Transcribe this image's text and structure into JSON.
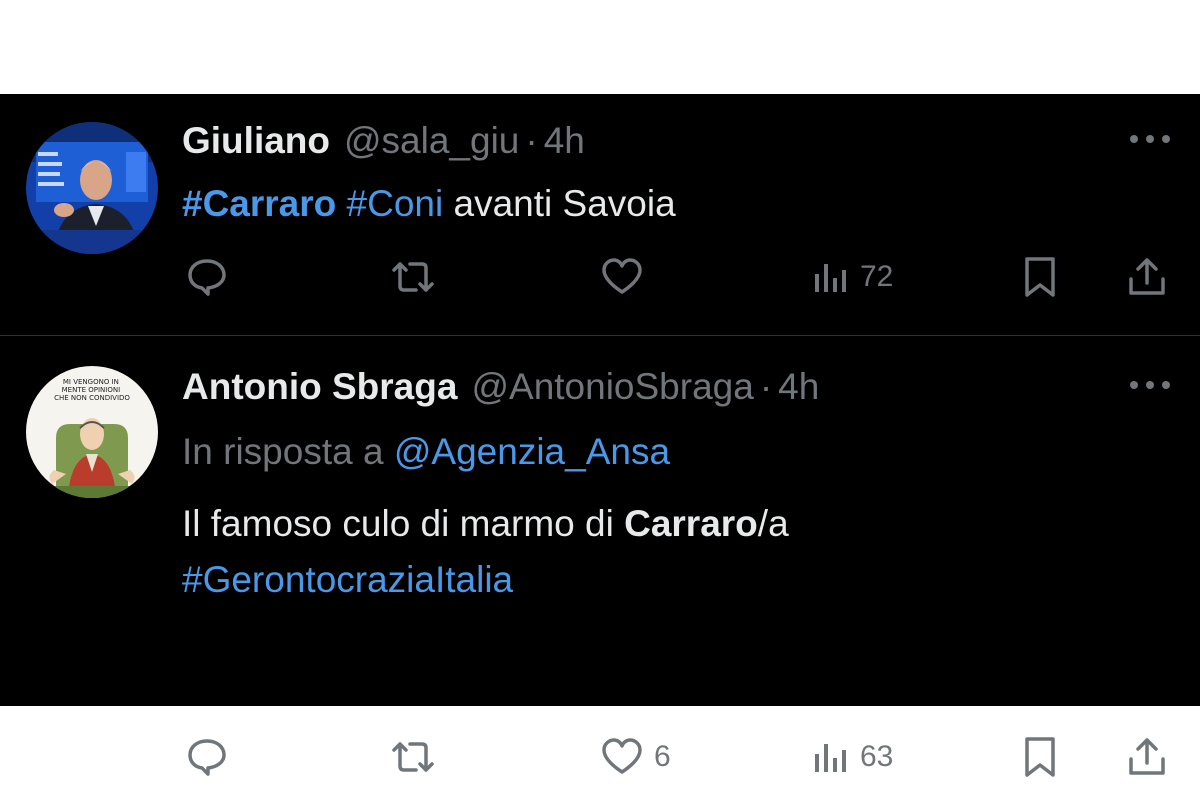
{
  "tweets": [
    {
      "name": "Giuliano",
      "handle": "@sala_giu",
      "separator": "·",
      "time": "4h",
      "body_parts": [
        "#Carraro",
        " ",
        "#Coni",
        " avanti Savoia"
      ],
      "actions": {
        "reply_count": "",
        "retweet_count": "",
        "like_count": "",
        "views_count": "72"
      },
      "avatar": "tv-host-avatar"
    },
    {
      "name": "Antonio Sbraga",
      "handle": "@AntonioSbraga",
      "separator": "·",
      "time": "4h",
      "reply_to_prefix": "In risposta a ",
      "reply_to_handle": "@Agenzia_Ansa",
      "line1_parts": [
        "Il famoso culo di marmo di ",
        "Carraro",
        "/a"
      ],
      "line2": "#GerontocraziaItalia",
      "avatar_caption": "MI VENGONO IN MENTE OPINIONI CHE NON CONDIVIDO",
      "actions": {
        "reply_count": "",
        "retweet_count": "",
        "like_count": "6",
        "views_count": "63"
      },
      "avatar": "cartoon-avatar"
    }
  ],
  "colors": {
    "background": "#000000",
    "text": "#e7e9ea",
    "muted": "#71767b",
    "link": "#4a99e9",
    "divider": "#2f3336"
  }
}
